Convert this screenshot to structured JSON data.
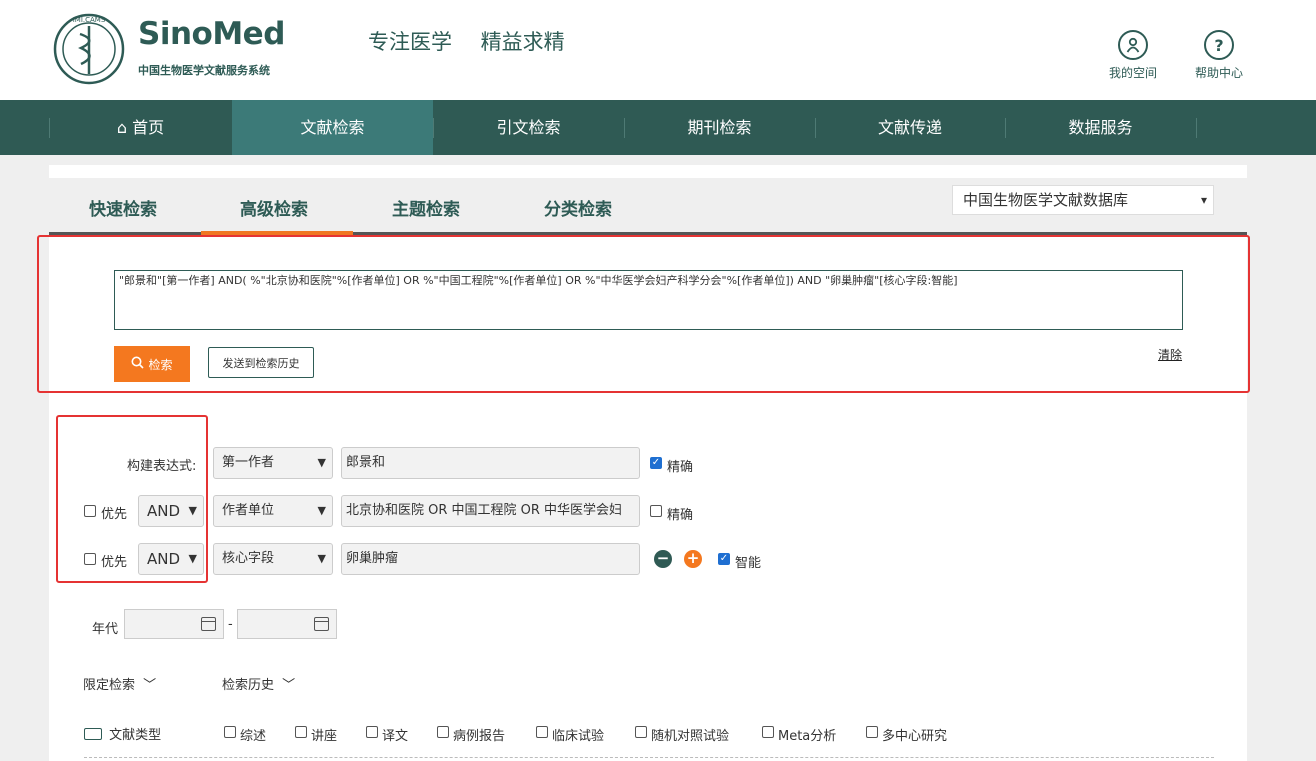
{
  "header": {
    "brand": "SinoMed",
    "brand_sub": "中国生物医学文献服务系统",
    "seal_text": "IMI.CAMS",
    "slogan": "专注医学 精益求精",
    "my_space": "我的空间",
    "help_center": "帮助中心"
  },
  "nav": {
    "items": [
      {
        "label": "首页",
        "icon": "home-icon"
      },
      {
        "label": "文献检索",
        "active": true
      },
      {
        "label": "引文检索"
      },
      {
        "label": "期刊检索"
      },
      {
        "label": "文献传递"
      },
      {
        "label": "数据服务"
      }
    ]
  },
  "tabs": [
    {
      "label": "快速检索"
    },
    {
      "label": "高级检索",
      "active": true
    },
    {
      "label": "主题检索"
    },
    {
      "label": "分类检索"
    }
  ],
  "database_select": "中国生物医学文献数据库",
  "query": {
    "expression": "\"郎景和\"[第一作者] AND( %\"北京协和医院\"%[作者单位] OR %\"中国工程院\"%[作者单位] OR %\"中华医学会妇产科学分会\"%[作者单位]) AND \"卵巢肿瘤\"[核心字段:智能]",
    "search_label": "检索",
    "send_history_label": "发送到检索历史",
    "clear_label": "清除"
  },
  "builder": {
    "label": "构建表达式:",
    "rows": [
      {
        "field": "第一作者",
        "value": "郎景和",
        "option_label": "精确",
        "option_checked": true
      },
      {
        "priority_label": "优先",
        "operator": "AND",
        "field": "作者单位",
        "value": "北京协和医院 OR 中国工程院 OR 中华医学会妇",
        "option_label": "精确",
        "option_checked": false
      },
      {
        "priority_label": "优先",
        "operator": "AND",
        "field": "核心字段",
        "value": "卵巢肿瘤",
        "option_label": "智能",
        "option_checked": true
      }
    ]
  },
  "year": {
    "label": "年代",
    "separator": "-"
  },
  "filters": {
    "limit_label": "限定检索",
    "history_label": "检索历史",
    "doc_type_label": "文献类型",
    "doc_types": [
      "综述",
      "讲座",
      "译文",
      "病例报告",
      "临床试验",
      "随机对照试验",
      "Meta分析",
      "多中心研究"
    ]
  },
  "colors": {
    "brand": "#2e5b55",
    "nav_bg": "#2f5a54",
    "nav_active": "#3c7a78",
    "accent_orange": "#f4781f",
    "highlight_red": "#e53333",
    "checkbox_blue": "#1f6fd1"
  }
}
